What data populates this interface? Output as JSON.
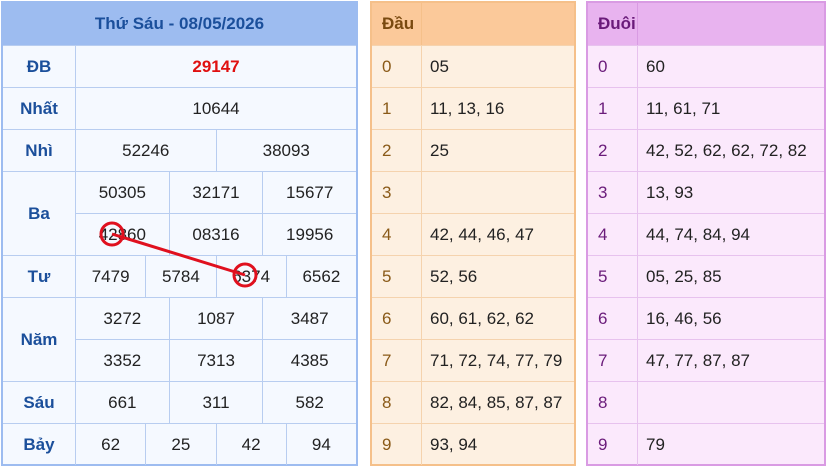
{
  "results": {
    "title": "Thứ Sáu - 08/05/2026",
    "rows": [
      {
        "label": "ĐB",
        "lines": [
          [
            "29147"
          ]
        ]
      },
      {
        "label": "Nhất",
        "lines": [
          [
            "10644"
          ]
        ]
      },
      {
        "label": "Nhì",
        "lines": [
          [
            "52246",
            "38093"
          ]
        ]
      },
      {
        "label": "Ba",
        "lines": [
          [
            "50305",
            "32171",
            "15677"
          ],
          [
            "42860",
            "08316",
            "19956"
          ]
        ]
      },
      {
        "label": "Tư",
        "lines": [
          [
            "7479",
            "5784",
            "6374",
            "6562"
          ]
        ]
      },
      {
        "label": "Năm",
        "lines": [
          [
            "3272",
            "1087",
            "3487"
          ],
          [
            "3352",
            "7313",
            "4385"
          ]
        ]
      },
      {
        "label": "Sáu",
        "lines": [
          [
            "661",
            "311",
            "582"
          ]
        ]
      },
      {
        "label": "Bảy",
        "lines": [
          [
            "62",
            "25",
            "42",
            "94"
          ]
        ]
      }
    ]
  },
  "dau": {
    "header": "Đầu",
    "rows": [
      {
        "k": "0",
        "v": "05"
      },
      {
        "k": "1",
        "v": "11, 13, 16"
      },
      {
        "k": "2",
        "v": "25"
      },
      {
        "k": "3",
        "v": ""
      },
      {
        "k": "4",
        "v": "42, 44, 46, 47"
      },
      {
        "k": "5",
        "v": "52, 56"
      },
      {
        "k": "6",
        "v": "60, 61, 62, 62"
      },
      {
        "k": "7",
        "v": "71, 72, 74, 77, 79"
      },
      {
        "k": "8",
        "v": "82, 84, 85, 87, 87"
      },
      {
        "k": "9",
        "v": "93, 94"
      }
    ]
  },
  "duoi": {
    "header": "Đuôi",
    "rows": [
      {
        "k": "0",
        "v": "60"
      },
      {
        "k": "1",
        "v": "11, 61, 71"
      },
      {
        "k": "2",
        "v": "42, 52, 62, 62, 72, 82"
      },
      {
        "k": "3",
        "v": "13, 93"
      },
      {
        "k": "4",
        "v": "44, 74, 84, 94"
      },
      {
        "k": "5",
        "v": "05, 25, 85"
      },
      {
        "k": "6",
        "v": "16, 46, 56"
      },
      {
        "k": "7",
        "v": "47, 77, 87, 87"
      },
      {
        "k": "8",
        "v": ""
      },
      {
        "k": "9",
        "v": "79"
      }
    ]
  },
  "colors": {
    "accent_blue": "#1b4f9b",
    "special_red": "#e01010",
    "annotation_red": "#e0101e"
  }
}
